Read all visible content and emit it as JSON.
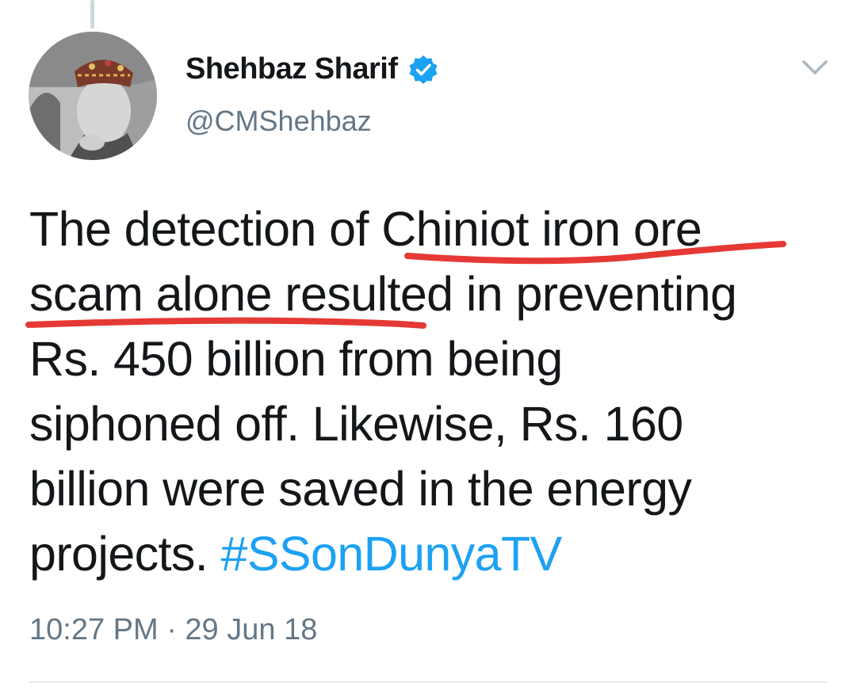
{
  "author": {
    "display_name": "Shehbaz Sharif",
    "handle": "@CMShehbaz",
    "verified": true,
    "avatar_icon": "profile-photo"
  },
  "tweet": {
    "lines": [
      "The detection of Chiniot iron ore",
      "scam alone resulted in preventing",
      "Rs. 450 billion from being",
      "siphoned off. Likewise, Rs. 160",
      "billion were saved in the energy"
    ],
    "last_line_text": "projects. ",
    "hashtag": "#SSonDunyaTV"
  },
  "meta": {
    "timestamp": "10:27 PM · 29 Jun 18"
  },
  "colors": {
    "text": "#14171a",
    "secondary": "#657786",
    "link": "#1da1f2",
    "verified": "#1da1f2",
    "annotation_underline": "#e53935"
  },
  "icons": {
    "verified": "verified-badge-icon",
    "menu": "chevron-down-icon"
  }
}
